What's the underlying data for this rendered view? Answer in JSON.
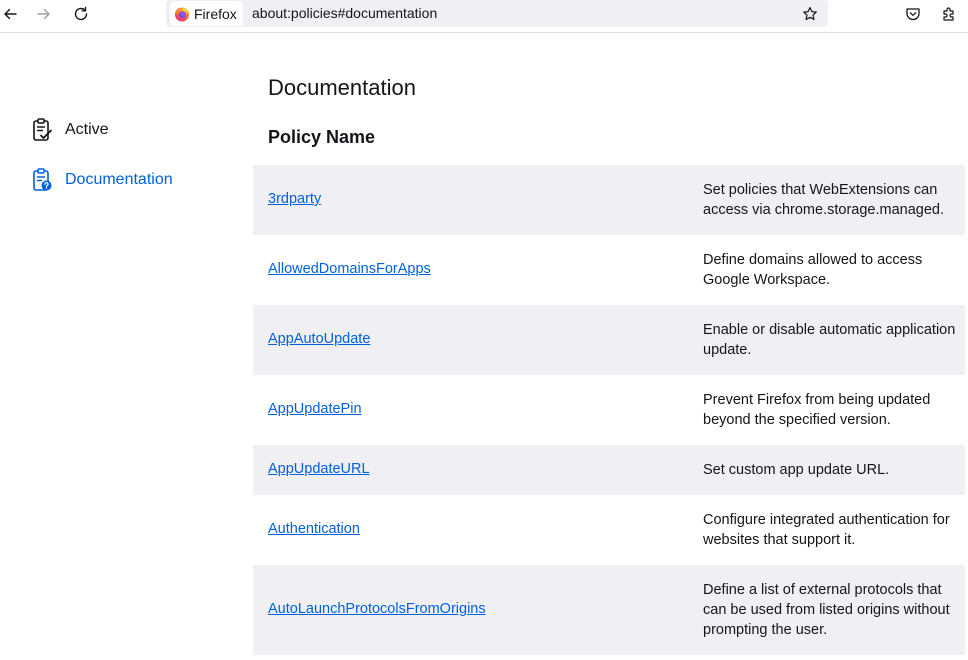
{
  "browser": {
    "identity_label": "Firefox",
    "url": "about:policies#documentation",
    "icons": {
      "back": "back-arrow-icon",
      "forward": "forward-arrow-icon",
      "reload": "reload-icon",
      "bookmark": "star-icon",
      "pocket": "pocket-icon",
      "extensions": "extensions-icon"
    }
  },
  "sidebar": {
    "items": [
      {
        "label": "Active",
        "icon": "clipboard-check-icon"
      },
      {
        "label": "Documentation",
        "icon": "clipboard-help-icon",
        "selected": true
      }
    ]
  },
  "main": {
    "title": "Documentation",
    "column_header": "Policy Name",
    "policies": [
      {
        "name": "3rdparty",
        "description": "Set policies that WebExtensions can access via chrome.storage.managed."
      },
      {
        "name": "AllowedDomainsForApps",
        "description": "Define domains allowed to access Google Workspace."
      },
      {
        "name": "AppAutoUpdate",
        "description": "Enable or disable automatic application update."
      },
      {
        "name": "AppUpdatePin",
        "description": "Prevent Firefox from being updated beyond the specified version."
      },
      {
        "name": "AppUpdateURL",
        "description": "Set custom app update URL."
      },
      {
        "name": "Authentication",
        "description": "Configure integrated authentication for websites that support it."
      },
      {
        "name": "AutoLaunchProtocolsFromOrigins",
        "description": "Define a list of external protocols that can be used from listed origins without prompting the user."
      }
    ]
  },
  "colors": {
    "link": "#0061e0",
    "row_shade": "#f0f0f4",
    "text": "#15141a"
  }
}
